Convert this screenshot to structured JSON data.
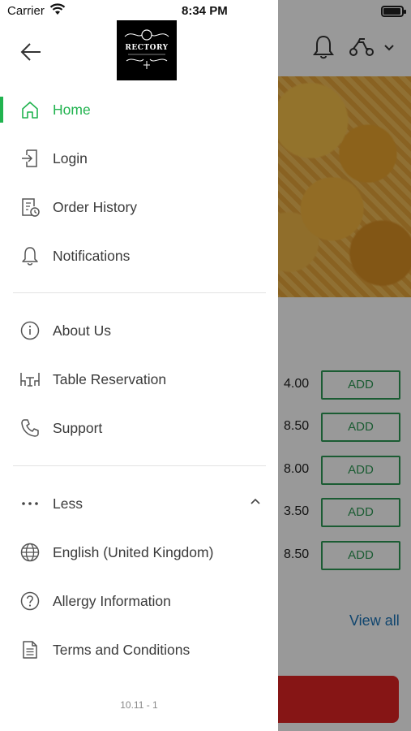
{
  "status_bar": {
    "carrier": "Carrier",
    "time": "8:34 PM"
  },
  "drawer": {
    "logo_text": "RECTORY",
    "primary_items": [
      {
        "label": "Home",
        "icon": "home-icon",
        "active": true
      },
      {
        "label": "Login",
        "icon": "login-icon"
      },
      {
        "label": "Order History",
        "icon": "order-history-icon"
      },
      {
        "label": "Notifications",
        "icon": "bell-icon"
      }
    ],
    "secondary_items": [
      {
        "label": "About Us",
        "icon": "info-icon"
      },
      {
        "label": "Table Reservation",
        "icon": "table-icon"
      },
      {
        "label": "Support",
        "icon": "phone-icon"
      }
    ],
    "less_label": "Less",
    "tertiary_items": [
      {
        "label": "English (United Kingdom)",
        "icon": "globe-icon"
      },
      {
        "label": "Allergy Information",
        "icon": "question-icon"
      },
      {
        "label": "Terms and Conditions",
        "icon": "document-icon"
      }
    ],
    "version": "10.11 - 1"
  },
  "background": {
    "prices": [
      "4.00",
      "8.50",
      "8.00",
      "3.50",
      "8.50"
    ],
    "add_label": "ADD",
    "view_all": "View all"
  },
  "colors": {
    "accent": "#21b34f",
    "add_button": "#2e9a55",
    "link": "#1a73b8",
    "cta": "#e02323"
  }
}
